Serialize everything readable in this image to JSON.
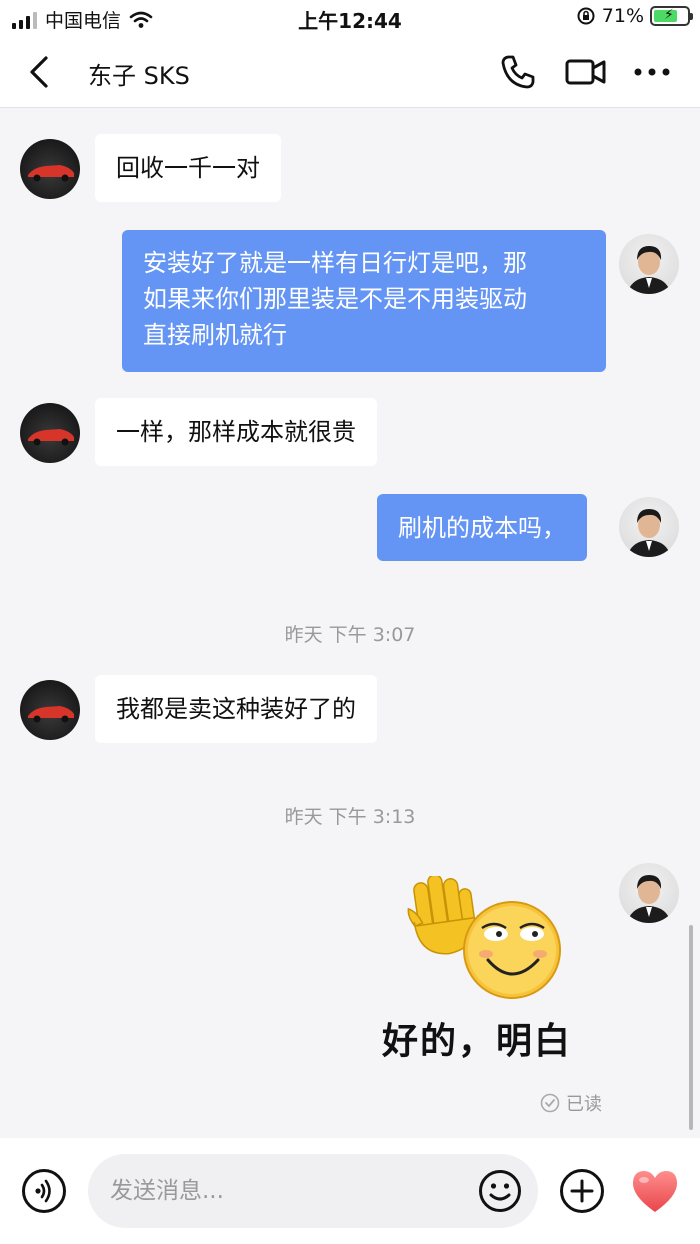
{
  "status_bar": {
    "carrier": "中国电信",
    "time": "上午12:44",
    "battery_percent": "71%",
    "battery_level": 0.71
  },
  "header": {
    "title": "东子 SKS",
    "icons": [
      "back-arrow-icon",
      "phone-icon",
      "video-camera-icon",
      "more-icon"
    ]
  },
  "messages": [
    {
      "side": "in",
      "text": "回收一千一对"
    },
    {
      "side": "out",
      "lines": [
        "安装好了就是一样有日行灯是吧，那",
        "如果来你们那里装是不是不用装驱动",
        "直接刷机就行"
      ]
    },
    {
      "side": "in",
      "text": "一样，那样成本就很贵"
    },
    {
      "side": "out",
      "text": "刷机的成本吗，"
    },
    {
      "type": "time",
      "text": "昨天  下午 3:07"
    },
    {
      "side": "in",
      "text": "我都是卖这种装好了的"
    },
    {
      "type": "time",
      "text": "昨天  下午 3:13"
    },
    {
      "side": "out",
      "type": "sticker",
      "text": "好的，明白"
    }
  ],
  "read_status": "已读",
  "input_bar": {
    "placeholder": "发送消息...",
    "icons": [
      "voice-icon",
      "emoji-icon",
      "add-icon",
      "heart-icon"
    ]
  },
  "colors": {
    "outgoing_bubble": "#6495f5",
    "incoming_bubble": "#ffffff",
    "background": "#f5f5f7",
    "heart": "#f06a6a"
  }
}
